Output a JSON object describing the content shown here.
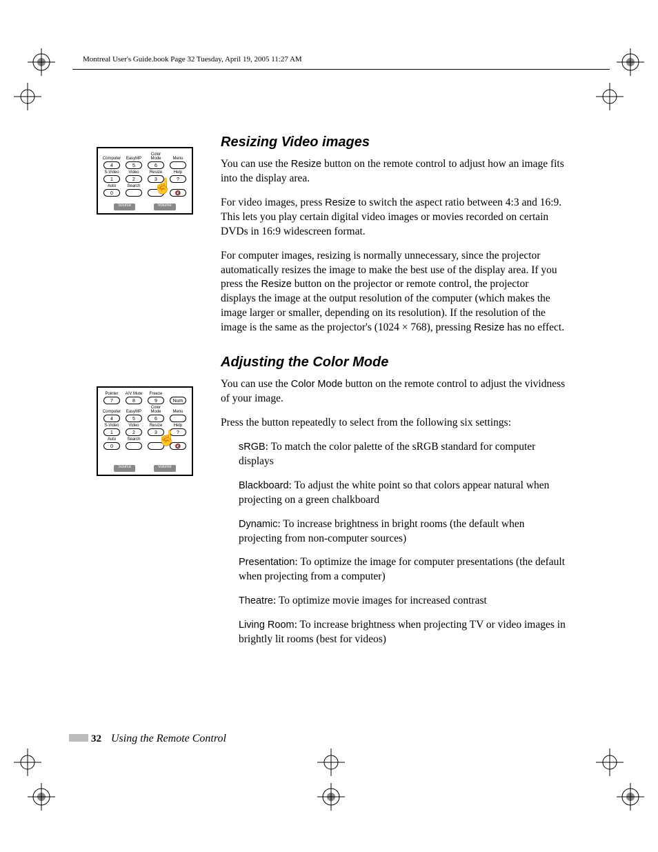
{
  "header": "Montreal User's Guide.book  Page 32  Tuesday, April 19, 2005  11:27 AM",
  "section1": {
    "heading": "Resizing Video images",
    "p1a": "You can use the ",
    "p1b": "Resize",
    "p1c": " button on the remote control to adjust how an image fits into the display area.",
    "p2a": "For video images, press ",
    "p2b": "Resize",
    "p2c": " to switch the aspect ratio between 4:3 and 16:9. This lets you play certain digital video images or movies recorded on certain DVDs in 16:9 widescreen format.",
    "p3a": "For computer images, resizing is normally unnecessary, since the projector automatically resizes the image to make the best use of the display area. If you press the ",
    "p3b": "Resize",
    "p3c": " button on the projector or remote control, the projector displays the image at the output resolution of the computer (which makes the image larger or smaller, depending on its resolution). If the resolution of the image is the same as the projector's (1024 × 768), pressing ",
    "p3d": "Resize",
    "p3e": " has no effect."
  },
  "section2": {
    "heading": "Adjusting the Color Mode",
    "p1a": "You can use the ",
    "p1b": "Color Mode",
    "p1c": " button on the remote control to adjust the vividness of your image.",
    "p2": "Press the button repeatedly to select from the following six settings:",
    "modes": {
      "m1n": "sRGB",
      "m1d": ": To match the color palette of the sRGB standard for computer displays",
      "m2n": "Blackboard",
      "m2d": ": To adjust the white point so that colors appear natural when projecting on a green chalkboard",
      "m3n": "Dynamic",
      "m3d": ": To increase brightness in bright rooms (the default when projecting from non-computer sources)",
      "m4n": "Presentation",
      "m4d": ": To optimize the image for computer presentations (the default when projecting from a computer)",
      "m5n": "Theatre",
      "m5d": ": To optimize movie images for increased contrast",
      "m6n": "Living Room",
      "m6d": ": To increase brightness when projecting TV or video images in brightly lit rooms (best for videos)"
    }
  },
  "remote": {
    "row_a": [
      "Pointer",
      "A/V Mute",
      "Freeze",
      ""
    ],
    "btn_a": [
      "7",
      "8",
      "9",
      "Num"
    ],
    "row_b": [
      "Computer",
      "EasyMP",
      "Color Mode",
      "Menu"
    ],
    "btn_b": [
      "4",
      "5",
      "6",
      ""
    ],
    "row_c": [
      "S-Video",
      "Video",
      "Resize",
      "Help"
    ],
    "btn_c": [
      "1",
      "2",
      "3",
      "?"
    ],
    "row_d": [
      "Auto",
      "Search",
      "",
      ""
    ],
    "btn_d": [
      "0",
      "",
      "",
      "🔇"
    ],
    "bottom1": "Source",
    "bottom2": "Volume"
  },
  "footer": {
    "page": "32",
    "chapter": "Using the Remote Control"
  }
}
